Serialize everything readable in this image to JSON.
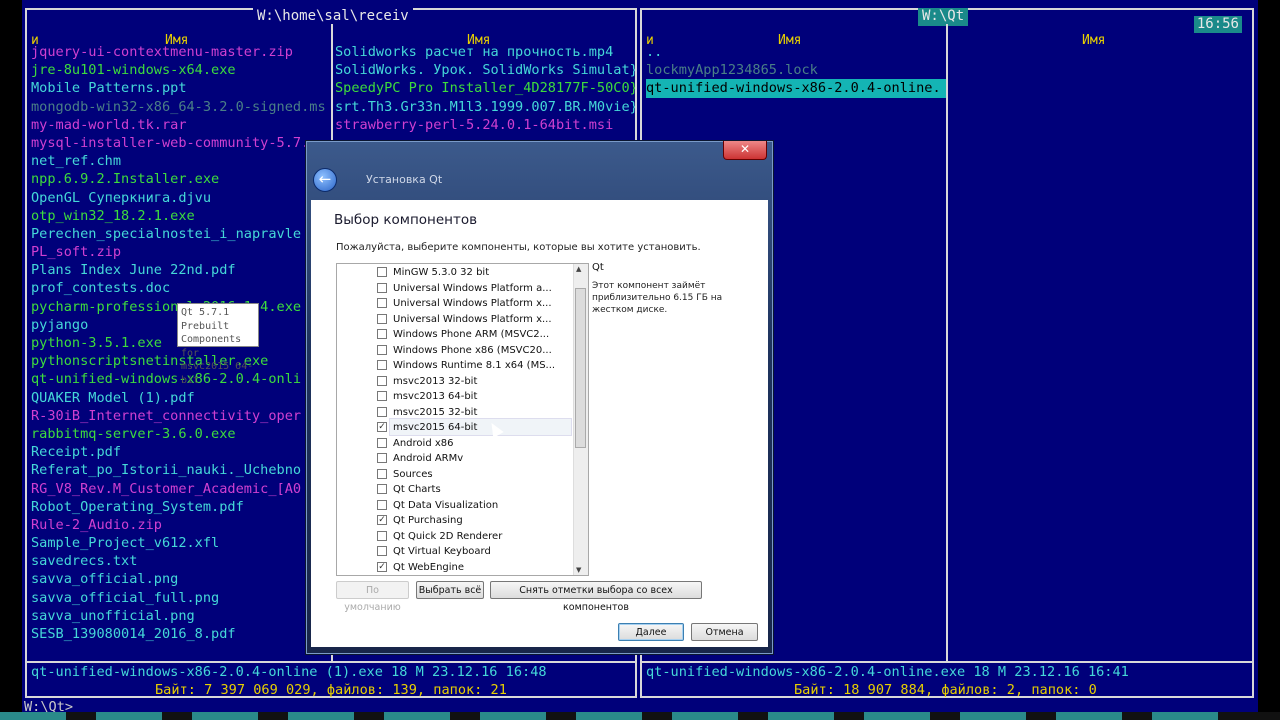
{
  "left_panel": {
    "title": "W:\\home\\sal\\receiv",
    "col_headers": [
      "и",
      "Имя",
      "Имя"
    ],
    "col1_files": [
      {
        "name": "jquery-ui-contextmenu-master.zip",
        "type": "arc"
      },
      {
        "name": "jre-8u101-windows-x64.exe",
        "type": "exe"
      },
      {
        "name": "Mobile Patterns.ppt",
        "type": "doc"
      },
      {
        "name": "mongodb-win32-x86_64-3.2.0-signed.ms",
        "type": "dim"
      },
      {
        "name": "my-mad-world.tk.rar",
        "type": "arc"
      },
      {
        "name": "mysql-installer-web-community-5.7.",
        "type": "arc"
      },
      {
        "name": "net_ref.chm",
        "type": "doc"
      },
      {
        "name": "npp.6.9.2.Installer.exe",
        "type": "exe"
      },
      {
        "name": "OpenGL Суперкнига.djvu",
        "type": "doc"
      },
      {
        "name": "otp_win32_18.2.1.exe",
        "type": "exe"
      },
      {
        "name": "Perechen_specialnostei_i_napravle",
        "type": "doc"
      },
      {
        "name": "PL_soft.zip",
        "type": "arc"
      },
      {
        "name": "Plans Index June 22nd.pdf",
        "type": "doc"
      },
      {
        "name": "prof_contests.doc",
        "type": "doc"
      },
      {
        "name": "pycharm-professional-2016.1.4.exe",
        "type": "exe"
      },
      {
        "name": "pyjango",
        "type": "doc"
      },
      {
        "name": "python-3.5.1.exe",
        "type": "exe"
      },
      {
        "name": "pythonscriptsnetinstaller.exe",
        "type": "exe"
      },
      {
        "name": "qt-unified-windows-x86-2.0.4-onli",
        "type": "exe"
      },
      {
        "name": "QUAKER Model (1).pdf",
        "type": "doc"
      },
      {
        "name": "R-30iB_Internet_connectivity_oper",
        "type": "arc"
      },
      {
        "name": "rabbitmq-server-3.6.0.exe",
        "type": "exe"
      },
      {
        "name": "Receipt.pdf",
        "type": "doc"
      },
      {
        "name": "Referat_po_Istorii_nauki._Uchebno",
        "type": "doc"
      },
      {
        "name": "RG_V8_Rev.M_Customer_Academic_[A0",
        "type": "arc"
      },
      {
        "name": "Robot_Operating_System.pdf",
        "type": "doc"
      },
      {
        "name": "Rule-2_Audio.zip",
        "type": "arc"
      },
      {
        "name": "Sample_Project_v612.xfl",
        "type": "doc"
      },
      {
        "name": "savedrecs.txt",
        "type": "doc"
      },
      {
        "name": "savva_official.png",
        "type": "doc"
      },
      {
        "name": "savva_official_full.png",
        "type": "doc"
      },
      {
        "name": "savva_unofficial.png",
        "type": "doc"
      },
      {
        "name": "SESB_139080014_2016_8.pdf",
        "type": "doc"
      }
    ],
    "col2_files": [
      {
        "name": "Solidworks расчет на прочность.mp4",
        "type": "doc"
      },
      {
        "name": "SolidWorks. Урок. SolidWorks Simulat}",
        "type": "doc"
      },
      {
        "name": "SpeedyPC Pro Installer_4D28177F-50C0}",
        "type": "exe"
      },
      {
        "name": "srt.Th3.Gr33n.M1l3.1999.007.BR.M0vie}",
        "type": "doc"
      },
      {
        "name": "strawberry-perl-5.24.0.1-64bit.msi",
        "type": "arc"
      }
    ],
    "status_line": "qt-unified-windows-x86-2.0.4-online (1).exe         18 М 23.12.16 16:48",
    "info_line": "Байт: 7 397 069 029, файлов: 139, папок: 21"
  },
  "right_panel": {
    "title": "W:\\Qt",
    "clock": "16:56",
    "col_headers": [
      "и",
      "Имя",
      "Имя"
    ],
    "files": [
      {
        "name": "..",
        "type": "doc"
      },
      {
        "name": "lockmyApp1234865.lock",
        "type": "dim"
      },
      {
        "name": "qt-unified-windows-x86-2.0.4-online.",
        "type": "sel"
      }
    ],
    "status_line": "qt-unified-windows-x86-2.0.4-online.exe             18 М 23.12.16 16:41",
    "info_line": "Байт: 18 907 884, файлов: 2, папок: 0"
  },
  "command_line": "W:\\Qt>",
  "dialog": {
    "window_title": "Установка Qt",
    "heading": "Выбор компонентов",
    "description": "Пожалуйста, выберите компоненты, которые вы хотите установить.",
    "components": [
      {
        "label": "MinGW 5.3.0 32 bit",
        "checked": false
      },
      {
        "label": "Universal Windows Platform a...",
        "checked": false
      },
      {
        "label": "Universal Windows Platform x...",
        "checked": false
      },
      {
        "label": "Universal Windows Platform x...",
        "checked": false
      },
      {
        "label": "Windows Phone ARM (MSVC2...",
        "checked": false
      },
      {
        "label": "Windows Phone x86 (MSVC20...",
        "checked": false
      },
      {
        "label": "Windows Runtime 8.1 x64 (MS...",
        "checked": false
      },
      {
        "label": "msvc2013 32-bit",
        "checked": false
      },
      {
        "label": "msvc2013 64-bit",
        "checked": false
      },
      {
        "label": "msvc2015 32-bit",
        "checked": false
      },
      {
        "label": "msvc2015 64-bit",
        "checked": true
      },
      {
        "label": "Android x86",
        "checked": false
      },
      {
        "label": "Android ARMv",
        "checked": false
      },
      {
        "label": "Sources",
        "checked": false
      },
      {
        "label": "Qt Charts",
        "checked": false
      },
      {
        "label": "Qt Data Visualization",
        "checked": false
      },
      {
        "label": "Qt Purchasing",
        "checked": true
      },
      {
        "label": "Qt Quick 2D Renderer",
        "checked": false
      },
      {
        "label": "Qt Virtual Keyboard",
        "checked": false
      },
      {
        "label": "Qt WebEngine",
        "checked": true
      }
    ],
    "tooltip_lines": [
      "Qt 5.7.1 Prebuilt",
      "Components for",
      "msvc2015 64-bit"
    ],
    "component_name": "Qt",
    "component_desc": "Этот компонент займёт приблизительно 6.15 ГБ на жестком диске.",
    "btn_default": "По умолчанию",
    "btn_select_all": "Выбрать всё",
    "btn_deselect_all": "Снять отметки выбора со всех компонентов",
    "btn_next": "Далее",
    "btn_cancel": "Отмена",
    "close_glyph": "✕",
    "back_glyph": "←"
  }
}
